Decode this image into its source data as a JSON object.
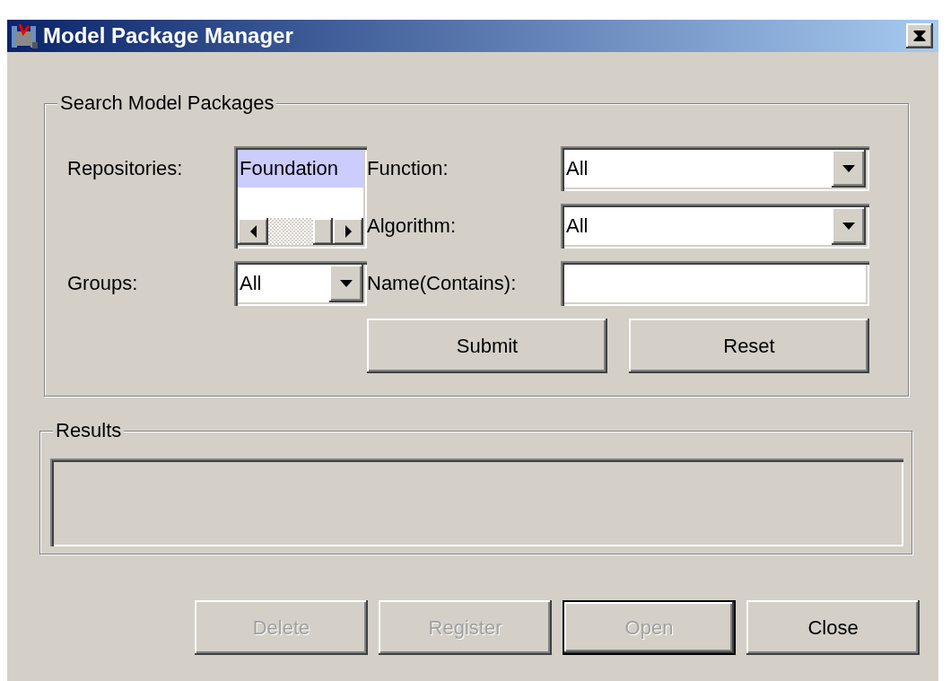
{
  "window": {
    "title": "Model Package Manager"
  },
  "search": {
    "legend": "Search Model Packages",
    "repositories": {
      "label": "Repositories:",
      "items": [
        {
          "text": "Foundation",
          "selected": true
        }
      ]
    },
    "function": {
      "label": "Function:",
      "value": "All"
    },
    "algorithm": {
      "label": "Algorithm:",
      "value": "All"
    },
    "groups": {
      "label": "Groups:",
      "value": "All"
    },
    "name": {
      "label": "Name(Contains):"
    },
    "buttons": [
      {
        "label": "Submit",
        "disabled": false,
        "default": false
      },
      {
        "label": "Reset",
        "disabled": false,
        "default": false
      }
    ]
  },
  "results": {
    "legend": "Results"
  },
  "buttons": [
    {
      "label": "Delete",
      "disabled": true,
      "default": false
    },
    {
      "label": "Register",
      "disabled": true,
      "default": false
    },
    {
      "label": "Open",
      "disabled": true,
      "default": true
    },
    {
      "label": "Close",
      "disabled": false,
      "default": false
    }
  ]
}
